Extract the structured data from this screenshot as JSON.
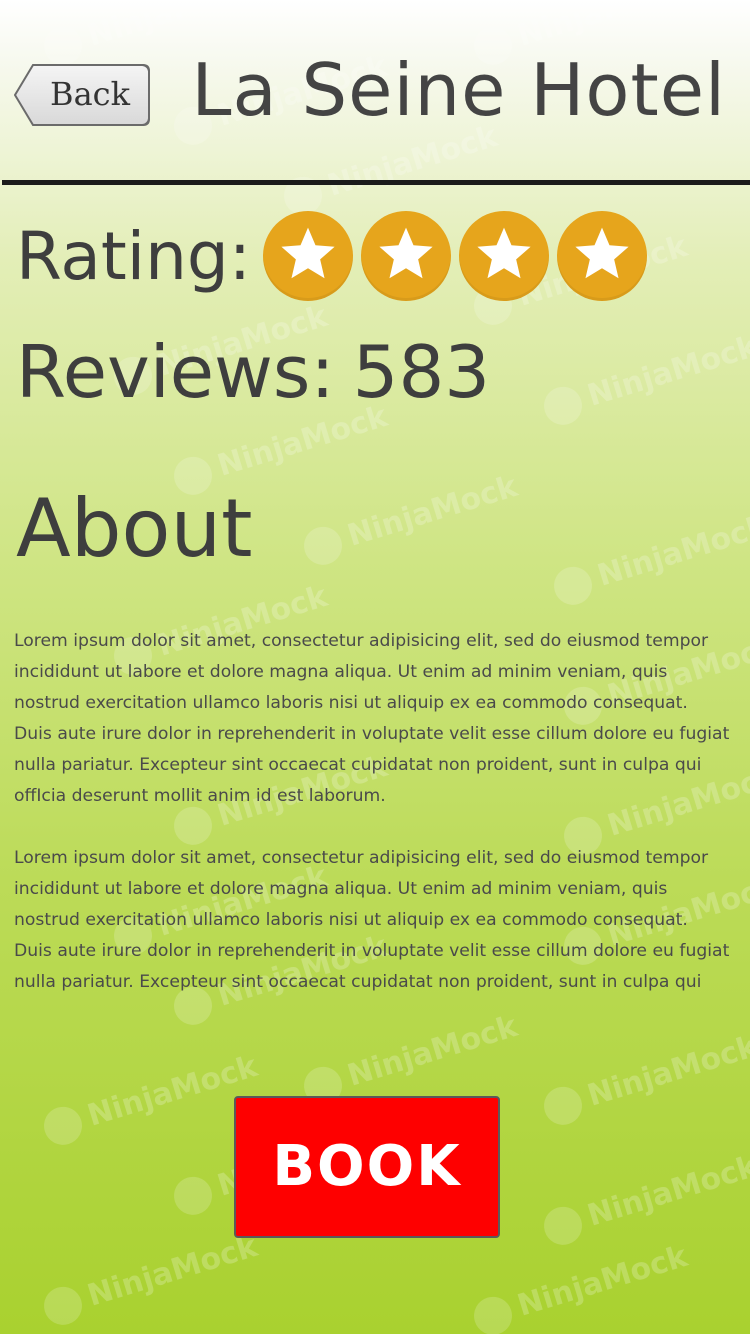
{
  "header": {
    "back_label": "Back",
    "title": "La Seine Hotel"
  },
  "rating": {
    "label": "Rating:",
    "stars": 4,
    "star_color": "#e6a51c"
  },
  "reviews": {
    "label": "Reviews:",
    "count": "583"
  },
  "about": {
    "heading": "About",
    "paragraphs": [
      "Lorem ipsum dolor sit amet, consectetur adipisicing elit, sed do eiusmod tempor incididunt ut labore et dolore magna aliqua. Ut enim ad minim veniam, quis nostrud exercitation ullamco laboris nisi ut aliquip ex ea commodo consequat. Duis aute irure dolor in reprehenderit in voluptate velit esse cillum dolore eu fugiat nulla pariatur. Excepteur sint occaecat cupidatat non proident, sunt in culpa qui offIcia deserunt mollit anim id est laborum.",
      "Lorem ipsum dolor sit amet, consectetur adipisicing elit, sed do eiusmod tempor incididunt ut labore et dolore magna aliqua. Ut enim ad minim veniam, quis nostrud exercitation ullamco laboris nisi ut aliquip ex ea commodo consequat. Duis aute irure dolor in reprehenderit in voluptate velit esse cillum dolore eu fugiat nulla pariatur. Excepteur sint occaecat cupidatat non proident, sunt in culpa qui offIcia deserunt mollit"
    ]
  },
  "book": {
    "label": "BOOK",
    "color": "#fe0000"
  },
  "watermark": {
    "text": "NinjaMock"
  },
  "colors": {
    "background_top": "#ffffff",
    "background_bottom": "#a9d12f",
    "text": "#3e3e3e"
  }
}
